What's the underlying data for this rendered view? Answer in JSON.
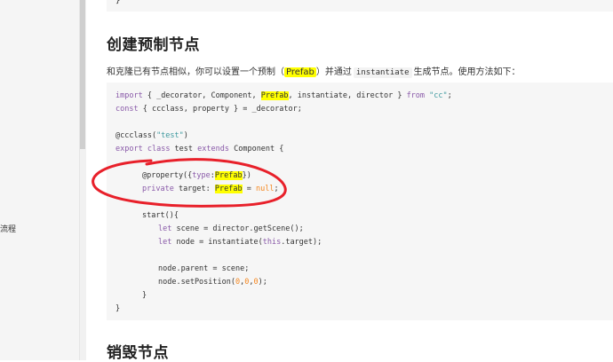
{
  "sidebar": {
    "truncated_item": "流程"
  },
  "previous_code_tail": "}",
  "section_create": {
    "title": "创建预制节点",
    "para_before": "和克隆已有节点相似，你可以设置一个预制（",
    "para_prefab": "Prefab",
    "para_middle": "）并通过",
    "para_code": "instantiate",
    "para_after": "生成节点。使用方法如下："
  },
  "code": {
    "l1_import": "import",
    "l1_a": " { _decorator, Component, ",
    "l1_prefab": "Prefab",
    "l1_b": ", instantiate, director } ",
    "l1_from": "from",
    "l1_sp": " ",
    "l1_str": "\"cc\"",
    "l1_end": ";",
    "l2_const": "const",
    "l2_rest": " { ccclass, property } = _decorator;",
    "l4_a": "@ccclass(",
    "l4_str": "\"test\"",
    "l4_b": ")",
    "l5_export": "export",
    "l5_sp": " ",
    "l5_class": "class",
    "l5_a": " test ",
    "l5_extends": "extends",
    "l5_b": " Component {",
    "l7_a": "@property({",
    "l7_type": "type",
    "l7_colon": ":",
    "l7_prefab": "Prefab",
    "l7_b": "})",
    "l8_private": "private",
    "l8_a": " target: ",
    "l8_prefab": "Prefab",
    "l8_b": " = ",
    "l8_null": "null",
    "l8_c": ";",
    "l10": "start(){",
    "l11_let": "let",
    "l11_rest": " scene = director.getScene();",
    "l12_let": "let",
    "l12_a": " node = instantiate(",
    "l12_this": "this",
    "l12_b": ".target);",
    "l14": "node.parent = scene;",
    "l15_a": "node.setPosition(",
    "l15_n1": "0",
    "l15_c1": ",",
    "l15_n2": "0",
    "l15_c2": ",",
    "l15_n3": "0",
    "l15_b": ");",
    "l16": "}",
    "l17": "}"
  },
  "section_destroy": {
    "title": "销毁节点"
  },
  "colors": {
    "highlight": "#ffff00",
    "annotation": "#e8202a",
    "keyword": "#8959a8",
    "string": "#3e999f",
    "number": "#f5871f"
  }
}
